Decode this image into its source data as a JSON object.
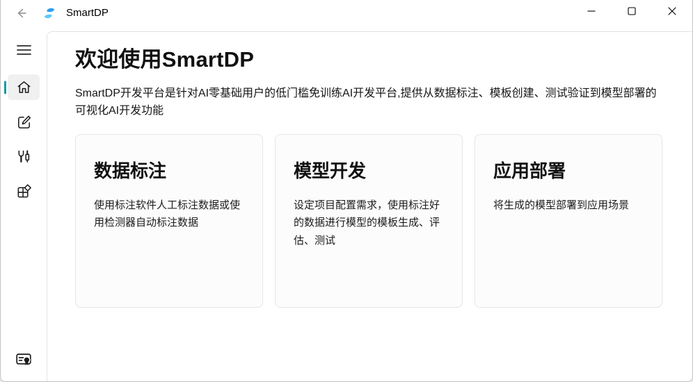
{
  "titlebar": {
    "app_title": "SmartDP",
    "back_icon": "back-arrow-icon",
    "controls": [
      "minimize-icon",
      "maximize-icon",
      "close-icon"
    ]
  },
  "sidebar": {
    "menu_icon": "hamburger-menu-icon",
    "items": [
      {
        "icon": "home-icon",
        "active": true
      },
      {
        "icon": "edit-compose-icon",
        "active": false
      },
      {
        "icon": "tools-wrench-screwdriver-icon",
        "active": false
      },
      {
        "icon": "apps-grid-icon",
        "active": false
      }
    ],
    "bottom_icon": "certificate-license-icon"
  },
  "main": {
    "heading": "欢迎使用SmartDP",
    "description": "SmartDP开发平台是针对AI零基础用户的低门槛免训练AI开发平台,提供从数据标注、模板创建、测试验证到模型部署的可视化AI开发功能",
    "cards": [
      {
        "title": "数据标注",
        "description": "使用标注软件人工标注数据或使用检测器自动标注数据"
      },
      {
        "title": "模型开发",
        "description": "设定项目配置需求，使用标注好的数据进行模型的模板生成、评估、测试"
      },
      {
        "title": "应用部署",
        "description": "将生成的模型部署到应用场景"
      }
    ]
  },
  "colors": {
    "accent": "#1599a8",
    "logo_dark": "#2e9df3",
    "logo_light": "#5ec8f6"
  }
}
